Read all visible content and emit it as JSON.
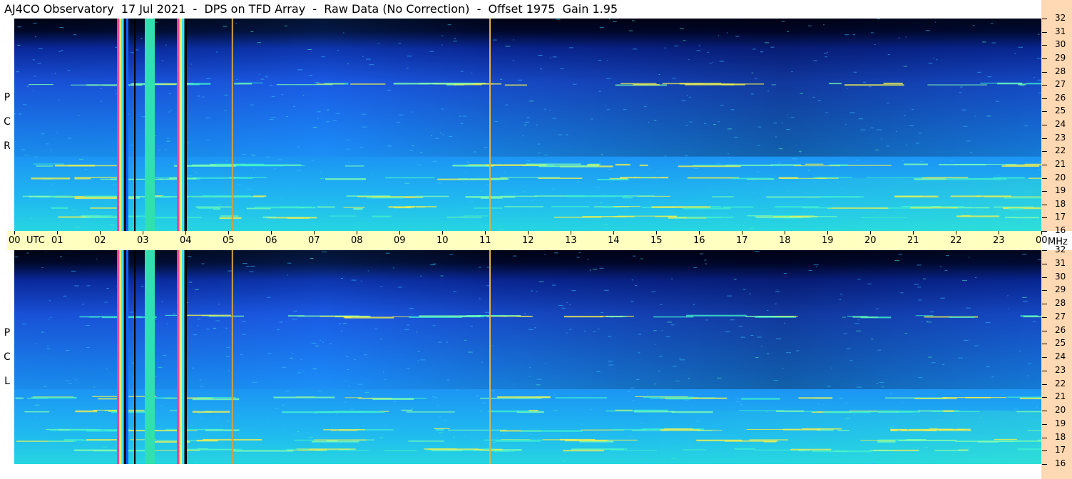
{
  "header": {
    "observatory": "AJ4CO Observatory",
    "date": "17 Jul 2021",
    "instrument": "DPS on TFD Array",
    "mode": "Raw Data (No Correction)",
    "offset": "Offset 1975",
    "gain": "Gain 1.95"
  },
  "axes": {
    "utc_label": "UTC",
    "mhz_label": "MHz"
  },
  "chart_data": {
    "type": "heatmap",
    "title": "AJ4CO Observatory  17 Jul 2021  -  DPS on TFD Array  -  Raw Data (No Correction)  -  Offset 1975  Gain 1.95",
    "xlabel": "UTC",
    "ylabel": "MHz",
    "x_ticks": [
      "00",
      "01",
      "02",
      "03",
      "04",
      "05",
      "06",
      "07",
      "08",
      "09",
      "10",
      "11",
      "12",
      "13",
      "14",
      "15",
      "16",
      "17",
      "18",
      "19",
      "20",
      "21",
      "22",
      "23",
      "00"
    ],
    "xlim": [
      0,
      24
    ],
    "ylim": [
      16,
      32
    ],
    "y_ticks": [
      32,
      31,
      30,
      29,
      28,
      27,
      26,
      25,
      24,
      23,
      22,
      21,
      20,
      19,
      18,
      17,
      16
    ],
    "panels": [
      {
        "name": "RCP",
        "label_letters": [
          "P",
          "C",
          "R"
        ]
      },
      {
        "name": "LCP",
        "label_letters": [
          "P",
          "C",
          "L"
        ]
      }
    ],
    "colors": {
      "background_high_freq_night": "#000814",
      "mid_blue": "#1a55e0",
      "light_blue": "#1aa0ff",
      "cyan": "#20d0e8",
      "interference_line": "#e0d040"
    },
    "vertical_interference_hours": [
      2.4,
      2.55,
      2.8,
      3.05,
      3.8,
      3.95,
      5.08,
      11.1
    ],
    "horizontal_bands_mhz": [
      27.1,
      17.8,
      17.1,
      21.0,
      20.0,
      18.6
    ]
  }
}
